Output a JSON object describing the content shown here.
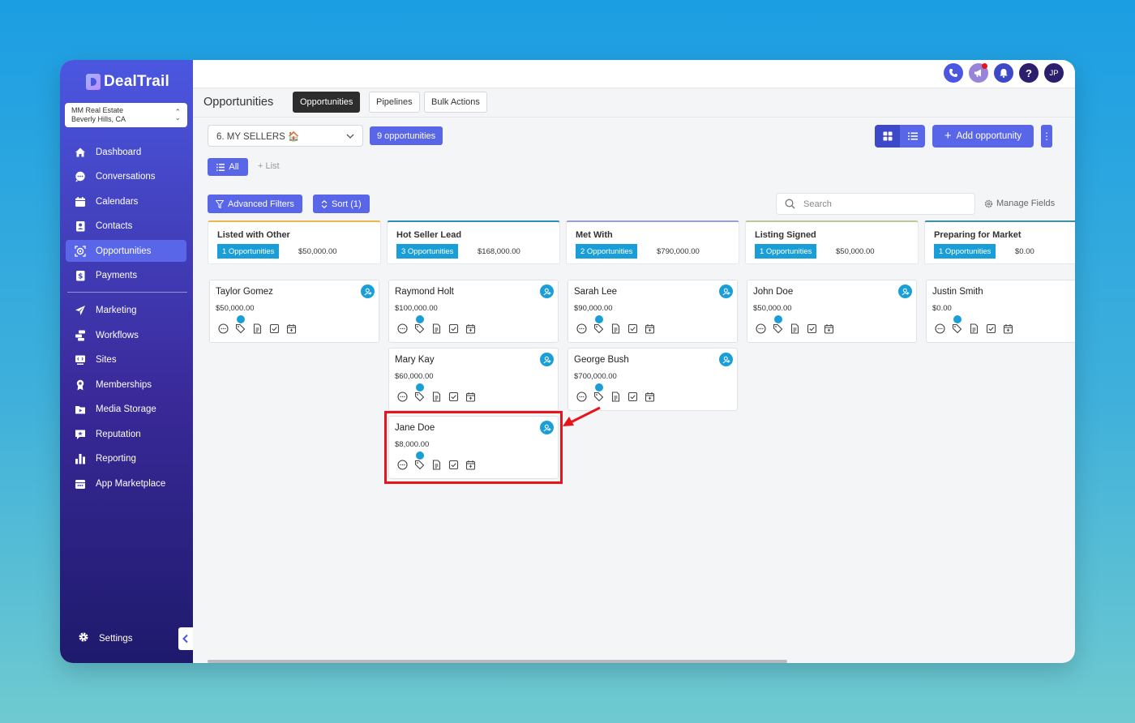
{
  "app": {
    "name": "DealTrail"
  },
  "account": {
    "name": "MM Real Estate",
    "location": "Beverly Hills, CA"
  },
  "nav": {
    "primary": [
      {
        "label": "Dashboard",
        "icon": "home-icon"
      },
      {
        "label": "Conversations",
        "icon": "chat-icon"
      },
      {
        "label": "Calendars",
        "icon": "calendar-icon"
      },
      {
        "label": "Contacts",
        "icon": "contact-card-icon"
      },
      {
        "label": "Opportunities",
        "icon": "target-icon",
        "active": true
      },
      {
        "label": "Payments",
        "icon": "payment-icon"
      }
    ],
    "secondary": [
      {
        "label": "Marketing",
        "icon": "paper-plane-icon"
      },
      {
        "label": "Workflows",
        "icon": "workflow-icon"
      },
      {
        "label": "Sites",
        "icon": "monitor-code-icon"
      },
      {
        "label": "Memberships",
        "icon": "award-icon"
      },
      {
        "label": "Media Storage",
        "icon": "media-folder-icon"
      },
      {
        "label": "Reputation",
        "icon": "star-chat-icon"
      },
      {
        "label": "Reporting",
        "icon": "bar-chart-icon"
      },
      {
        "label": "App Marketplace",
        "icon": "store-icon"
      }
    ],
    "settings_label": "Settings"
  },
  "topbar": {
    "avatar_initials": "JP",
    "help_label": "?"
  },
  "header": {
    "title": "Opportunities",
    "tabs": [
      "Opportunities",
      "Pipelines",
      "Bulk Actions"
    ]
  },
  "toolbar": {
    "pipeline": "6. MY SELLERS 🏠",
    "count": "9 opportunities",
    "add_label": "Add opportunity",
    "all_label": "All",
    "list_label": "List",
    "filters_label": "Advanced Filters",
    "sort_label": "Sort (1)",
    "search_placeholder": "Search",
    "manage_fields_label": "Manage Fields"
  },
  "columns": [
    {
      "title": "Listed with Other",
      "badge": "1 Opportunities",
      "total": "$50,000.00",
      "accent": "#e8b84a",
      "cards": [
        {
          "name": "Taylor Gomez",
          "amount": "$50,000.00"
        }
      ]
    },
    {
      "title": "Hot Seller Lead",
      "badge": "3 Opportunities",
      "total": "$168,000.00",
      "accent": "#2e8fb8",
      "cards": [
        {
          "name": "Raymond Holt",
          "amount": "$100,000.00"
        },
        {
          "name": "Mary Kay",
          "amount": "$60,000.00"
        },
        {
          "name": "Jane Doe",
          "amount": "$8,000.00"
        }
      ]
    },
    {
      "title": "Met With",
      "badge": "2 Opportunities",
      "total": "$790,000.00",
      "accent": "#9e9ed6",
      "cards": [
        {
          "name": "Sarah Lee",
          "amount": "$90,000.00"
        },
        {
          "name": "George Bush",
          "amount": "$700,000.00"
        }
      ]
    },
    {
      "title": "Listing Signed",
      "badge": "1 Opportunities",
      "total": "$50,000.00",
      "accent": "#b9c99a",
      "cards": [
        {
          "name": "John Doe",
          "amount": "$50,000.00"
        }
      ]
    },
    {
      "title": "Preparing for Market",
      "badge": "1 Opportunities",
      "total": "$0.00",
      "accent": "#3e8fa8",
      "cards": [
        {
          "name": "Justin Smith",
          "amount": "$0.00"
        }
      ]
    }
  ],
  "colors": {
    "primary": "#5a66e8",
    "badge": "#1a9ed8",
    "highlight": "#e8141a"
  }
}
